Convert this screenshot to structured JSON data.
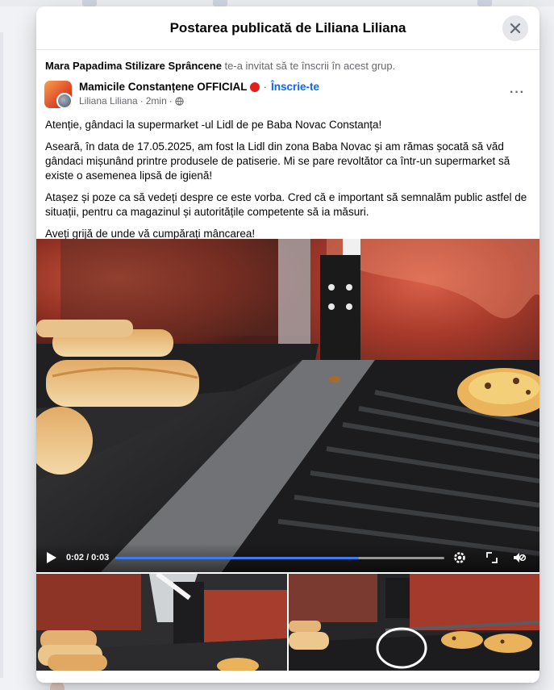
{
  "modal": {
    "title": "Postarea publicată de Liliana Liliana"
  },
  "invite": {
    "inviter": "Mara Papadima Stilizare Sprâncene",
    "text": " te-a invitat să te înscrii în acest grup."
  },
  "post": {
    "group_name": "Mamicile Constanțene OFFICIAL",
    "separator": "·",
    "join_label": "Înscrie-te",
    "author": "Liliana Liliana",
    "time": "2min",
    "more_label": "···",
    "paragraphs": [
      "Atenție, gândaci la supermarket -ul Lidl de pe Baba Novac Constanța!",
      "Aseară, în data de 17.05.2025, am fost la Lidl din zona Baba Novac și am rămas șocată să văd gândaci mișunând printre produsele de patiserie. Mi se pare revoltător ca într-un supermarket să existe o asemenea lipsă de igienă!",
      "Atașez și  poze ca să vedeți despre ce este vorba. Cred că e important să semnalăm public astfel de situații, pentru ca magazinul și autoritățile competente să ia măsuri.",
      "Aveți grijă de unde vă cumpărați mâncarea!"
    ]
  },
  "video": {
    "time_label": "0:02 / 0:03",
    "progress": 0.74
  },
  "colors": {
    "accent": "#0866ff",
    "progress": "#3f7bf0",
    "red_dot": "#e0201c"
  }
}
